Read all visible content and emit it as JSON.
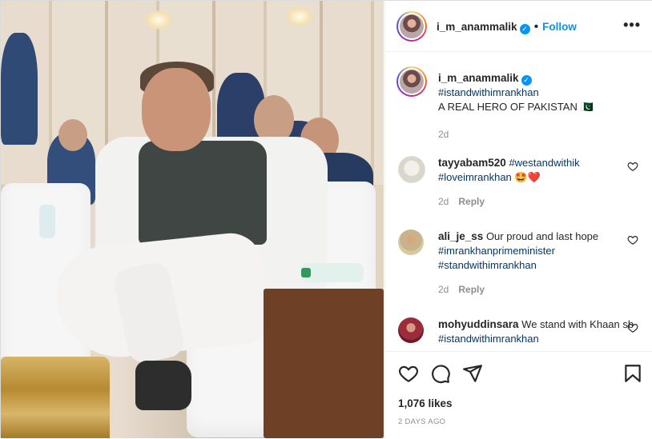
{
  "header": {
    "username": "i_m_anammalik",
    "verified_mark": "✓",
    "separator": "•",
    "follow_label": "Follow",
    "more_label": "•••"
  },
  "caption": {
    "username": "i_m_anammalik",
    "hashtag": "#istandwithimrankhan",
    "text": "A REAL HERO OF PAKISTAN 🇵🇰",
    "time": "2d"
  },
  "comments": [
    {
      "username": "tayyabam520",
      "segments": [
        {
          "text": "#westandwithik",
          "type": "tag"
        },
        {
          "text": " ",
          "type": "text"
        },
        {
          "text": "#loveimrankhan",
          "type": "tag"
        },
        {
          "text": " 🤩❤️",
          "type": "text"
        }
      ],
      "time": "2d",
      "reply_label": "Reply"
    },
    {
      "username": "ali_je_ss",
      "segments": [
        {
          "text": "Our proud and last hope ",
          "type": "text"
        },
        {
          "text": "#imrankhanprimeminister",
          "type": "tag"
        },
        {
          "text": " ",
          "type": "text"
        },
        {
          "text": "#standwithimrankhan",
          "type": "tag"
        }
      ],
      "time": "2d",
      "reply_label": "Reply"
    },
    {
      "username": "mohyuddinsara",
      "segments": [
        {
          "text": "We stand with Khaan sb ",
          "type": "text"
        },
        {
          "text": "#istandwithimrankhan",
          "type": "tag"
        }
      ],
      "time": "",
      "reply_label": ""
    }
  ],
  "actions": {
    "likes": "1,076 likes",
    "posted_ago": "2 DAYS AGO",
    "icons": [
      "heart-icon",
      "comment-icon",
      "share-icon",
      "bookmark-icon"
    ]
  },
  "colors": {
    "link_blue": "#0095f6",
    "hashtag": "#00376b",
    "muted": "#8e8e8e"
  }
}
